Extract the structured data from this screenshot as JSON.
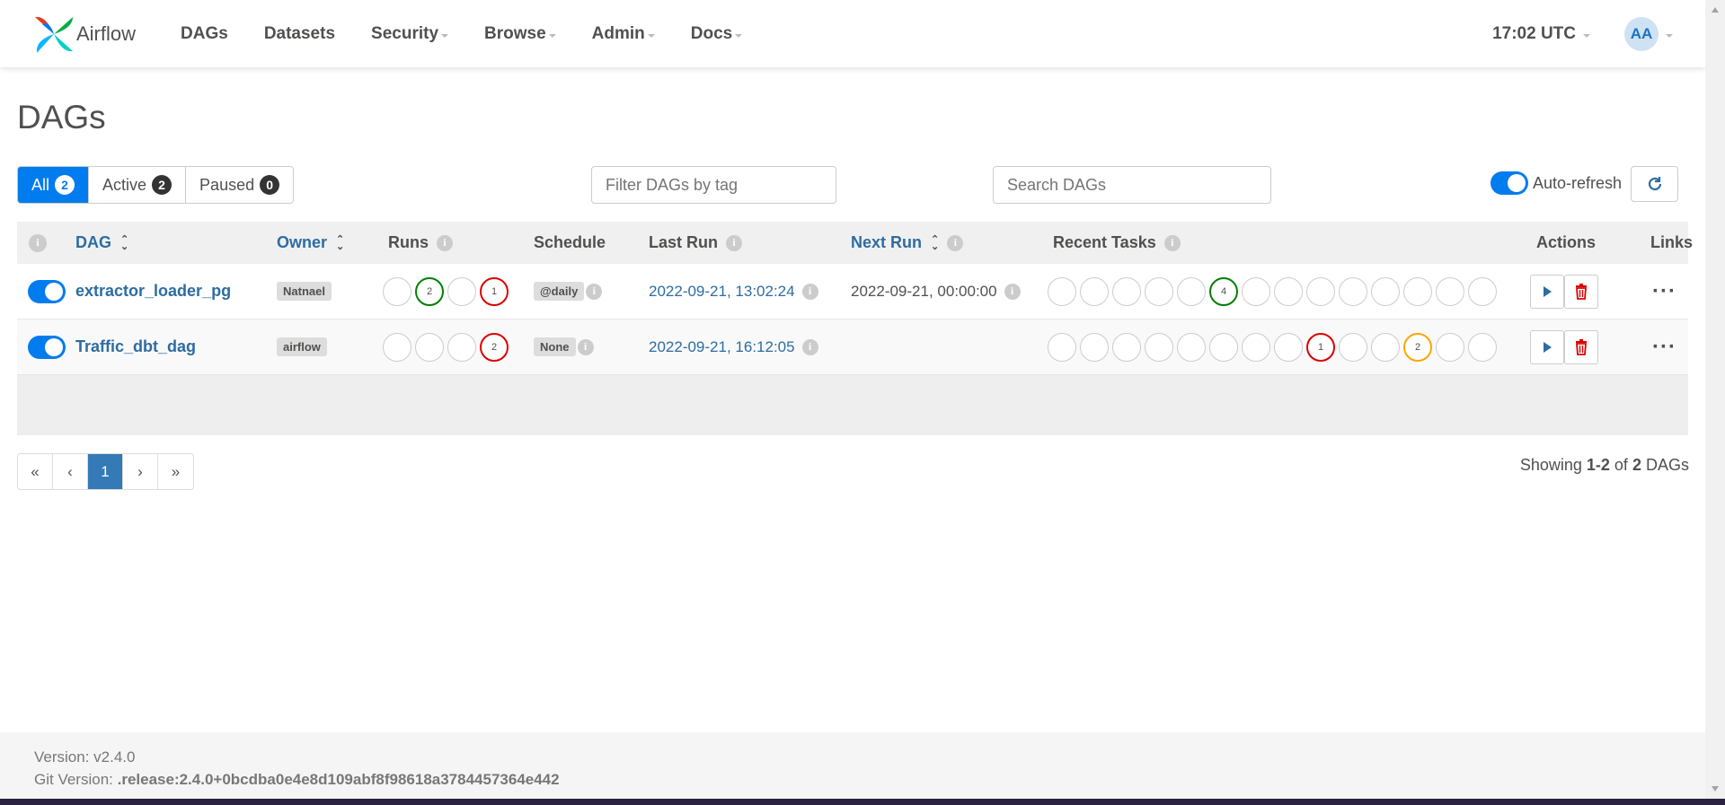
{
  "nav": {
    "brand": "Airflow",
    "items": [
      {
        "label": "DAGs",
        "dropdown": false
      },
      {
        "label": "Datasets",
        "dropdown": false
      },
      {
        "label": "Security",
        "dropdown": true
      },
      {
        "label": "Browse",
        "dropdown": true
      },
      {
        "label": "Admin",
        "dropdown": true
      },
      {
        "label": "Docs",
        "dropdown": true
      }
    ],
    "clock": "17:02 UTC",
    "avatar": "AA"
  },
  "page_title": "DAGs",
  "status_tabs": [
    {
      "label": "All",
      "count": "2",
      "active": true
    },
    {
      "label": "Active",
      "count": "2",
      "active": false
    },
    {
      "label": "Paused",
      "count": "0",
      "active": false
    }
  ],
  "tag_filter": {
    "placeholder": "Filter DAGs by tag"
  },
  "search": {
    "placeholder": "Search DAGs"
  },
  "auto_refresh_label": "Auto-refresh",
  "columns": {
    "dag": "DAG",
    "owner": "Owner",
    "runs": "Runs",
    "schedule": "Schedule",
    "last_run": "Last Run",
    "next_run": "Next Run",
    "recent_tasks": "Recent Tasks",
    "actions": "Actions",
    "links": "Links"
  },
  "dags": [
    {
      "name": "extractor_loader_pg",
      "owner": "Natnael",
      "runs": [
        "",
        "2",
        "",
        "1"
      ],
      "run_states": [
        "",
        "success",
        "",
        "failed"
      ],
      "schedule": "@daily",
      "last_run": "2022-09-21, 13:02:24",
      "next_run": "2022-09-21, 00:00:00",
      "recent_tasks": [
        "",
        "",
        "",
        "",
        "",
        "4",
        "",
        "",
        "",
        "",
        "",
        "",
        "",
        ""
      ],
      "task_states": [
        "",
        "",
        "",
        "",
        "",
        "success",
        "",
        "",
        "",
        "",
        "",
        "",
        "",
        ""
      ]
    },
    {
      "name": "Traffic_dbt_dag",
      "owner": "airflow",
      "runs": [
        "",
        "",
        "",
        "2"
      ],
      "run_states": [
        "",
        "",
        "",
        "failed"
      ],
      "schedule": "None",
      "last_run": "2022-09-21, 16:12:05",
      "next_run": "",
      "recent_tasks": [
        "",
        "",
        "",
        "",
        "",
        "",
        "",
        "",
        "1",
        "",
        "",
        "2",
        "",
        ""
      ],
      "task_states": [
        "",
        "",
        "",
        "",
        "",
        "",
        "",
        "",
        "failed",
        "",
        "",
        "up_for_retry",
        "",
        ""
      ]
    }
  ],
  "pagination": {
    "first": "«",
    "prev": "‹",
    "current": "1",
    "next": "›",
    "last": "»"
  },
  "showing": {
    "prefix": "Showing",
    "range": "1-2",
    "of": "of",
    "total": "2",
    "suffix": "DAGs"
  },
  "footer": {
    "version_label": "Version:",
    "version": "v2.4.0",
    "git_label": "Git Version:",
    "git_version": ".release:2.4.0+0bcdba0e4e8d109abf8f98618a3784457364e442"
  },
  "colors": {
    "accent": "#017cee",
    "success": "#008000",
    "failed": "#dd0000",
    "up_for_retry": "#ffa500",
    "link": "#2d6ca2"
  }
}
